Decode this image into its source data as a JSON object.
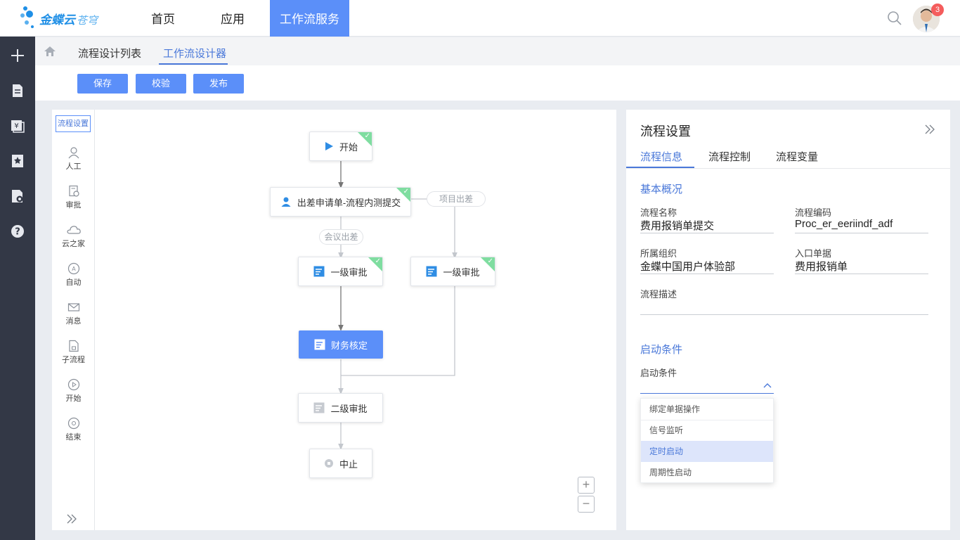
{
  "header": {
    "logo_text": "金蝶云",
    "logo_sub": "苍穹",
    "nav": [
      "首页",
      "应用",
      "工作流服务"
    ],
    "active_nav": "工作流服务",
    "notification_count": "3"
  },
  "breadcrumb": {
    "items": [
      "流程设计列表",
      "工作流设计器"
    ],
    "active": "工作流设计器"
  },
  "toolbar": {
    "save_label": "保存",
    "validate_label": "校验",
    "publish_label": "发布"
  },
  "palette": {
    "tab_label": "流程设置",
    "items": [
      "人工",
      "审批",
      "云之家",
      "自动",
      "消息",
      "子流程",
      "开始",
      "结束"
    ]
  },
  "flow": {
    "nodes": {
      "start": "开始",
      "apply": "出差申请单-流程内测提交",
      "approve1_left": "一级审批",
      "approve1_right": "一级审批",
      "finance": "财务核定",
      "approve2": "二级审批",
      "stop": "中止"
    },
    "conditions": {
      "meeting": "会议出差",
      "project": "项目出差"
    }
  },
  "panel": {
    "title": "流程设置",
    "tabs": [
      "流程信息",
      "流程控制",
      "流程变量"
    ],
    "active_tab": "流程信息",
    "basic_section": "基本概况",
    "fields": {
      "name_label": "流程名称",
      "name_value": "费用报销单提交",
      "code_label": "流程编码",
      "code_value": "Proc_er_eeriindf_adf",
      "org_label": "所属组织",
      "org_value": "金蝶中国用户体验部",
      "entry_label": "入口单据",
      "entry_value": "费用报销单",
      "desc_label": "流程描述",
      "desc_value": ""
    },
    "start_section": "启动条件",
    "start_label": "启动条件",
    "start_options": [
      "绑定单据操作",
      "信号监听",
      "定时启动",
      "周期性启动"
    ],
    "start_selected": "定时启动"
  },
  "colors": {
    "accent": "#5b8ff9",
    "sidebar": "#333846",
    "check": "#7fdda0"
  }
}
